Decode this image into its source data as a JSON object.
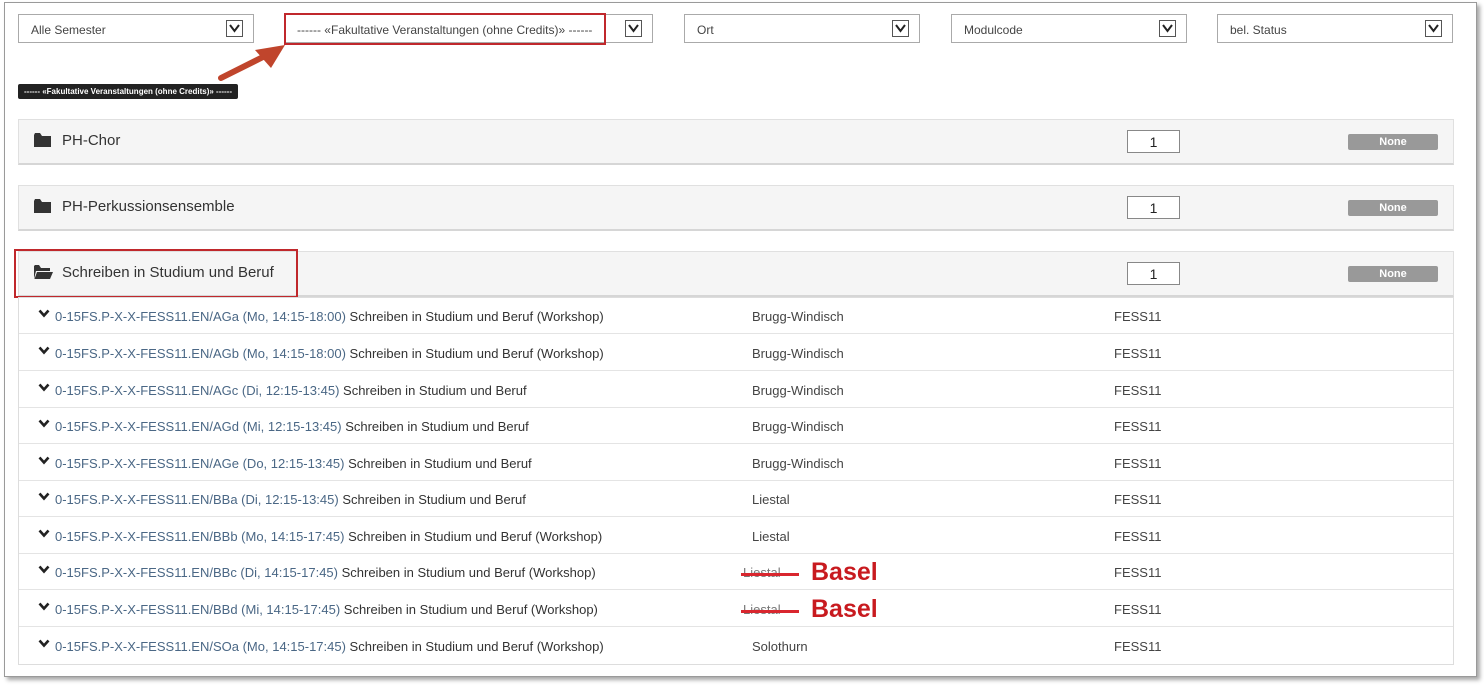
{
  "filters": [
    {
      "label": "Alle Semester"
    },
    {
      "label": "------ «Fakultative Veranstaltungen (ohne Credits)» ------"
    },
    {
      "label": "Ort"
    },
    {
      "label": "Modulcode"
    },
    {
      "label": "bel. Status"
    }
  ],
  "selected_tag": "------ «Fakultative Veranstaltungen (ohne Credits)» ------",
  "groups": [
    {
      "title": "PH-Chor",
      "count": "1",
      "status": "None",
      "state": "collapsed"
    },
    {
      "title": "PH-Perkussionsensemble",
      "count": "1",
      "status": "None",
      "state": "collapsed"
    },
    {
      "title": "Schreiben in Studium und Beruf",
      "count": "1",
      "status": "None",
      "state": "expanded"
    }
  ],
  "rows": [
    {
      "code": "0-15FS.P-X-X-FESS11.EN/AGa (Mo, 14:15-18:00)",
      "title": " Schreiben in Studium und Beruf (Workshop)",
      "ort": "Brugg-Windisch",
      "modul": "FESS11"
    },
    {
      "code": "0-15FS.P-X-X-FESS11.EN/AGb (Mo, 14:15-18:00)",
      "title": " Schreiben in Studium und Beruf (Workshop)",
      "ort": "Brugg-Windisch",
      "modul": "FESS11"
    },
    {
      "code": "0-15FS.P-X-X-FESS11.EN/AGc (Di, 12:15-13:45)",
      "title": " Schreiben in Studium und Beruf",
      "ort": "Brugg-Windisch",
      "modul": "FESS11"
    },
    {
      "code": "0-15FS.P-X-X-FESS11.EN/AGd (Mi, 12:15-13:45)",
      "title": " Schreiben in Studium und Beruf",
      "ort": "Brugg-Windisch",
      "modul": "FESS11"
    },
    {
      "code": "0-15FS.P-X-X-FESS11.EN/AGe (Do, 12:15-13:45)",
      "title": " Schreiben in Studium und Beruf",
      "ort": "Brugg-Windisch",
      "modul": "FESS11"
    },
    {
      "code": "0-15FS.P-X-X-FESS11.EN/BBa (Di, 12:15-13:45)",
      "title": " Schreiben in Studium und Beruf",
      "ort": "Liestal",
      "modul": "FESS11"
    },
    {
      "code": "0-15FS.P-X-X-FESS11.EN/BBb (Mo, 14:15-17:45)",
      "title": " Schreiben in Studium und Beruf (Workshop)",
      "ort": "Liestal",
      "modul": "FESS11"
    },
    {
      "code": "0-15FS.P-X-X-FESS11.EN/BBc (Di, 14:15-17:45)",
      "title": " Schreiben in Studium und Beruf (Workshop)",
      "ort_old": "Liestal",
      "ort_new": "Basel",
      "modul": "FESS11"
    },
    {
      "code": "0-15FS.P-X-X-FESS11.EN/BBd (Mi, 14:15-17:45)",
      "title": " Schreiben in Studium und Beruf (Workshop)",
      "ort_old": "Liestal",
      "ort_new": "Basel",
      "modul": "FESS11"
    },
    {
      "code": "0-15FS.P-X-X-FESS11.EN/SOa (Mo, 14:15-17:45)",
      "title": " Schreiben in Studium und Beruf (Workshop)",
      "ort": "Solothurn",
      "modul": "FESS11"
    }
  ],
  "colors": {
    "highlight": "#c0282c",
    "link": "#4a6785",
    "badge": "#999999",
    "correction": "#c81a1f"
  }
}
